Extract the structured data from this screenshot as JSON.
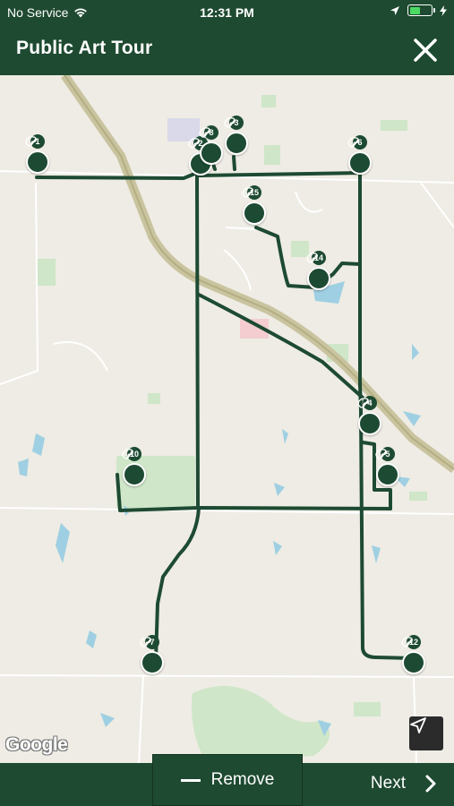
{
  "status_bar": {
    "carrier": "No Service",
    "time": "12:31 PM",
    "battery_level": 0.5
  },
  "header": {
    "title": "Public Art Tour",
    "close_icon": "close-x-icon"
  },
  "map": {
    "attribution": "Google",
    "route_color": "#1d4a32",
    "stops": [
      {
        "number": "1"
      },
      {
        "number": "2"
      },
      {
        "number": "3"
      },
      {
        "number": "4"
      },
      {
        "number": "5"
      },
      {
        "number": "6"
      },
      {
        "number": "7"
      },
      {
        "number": "8"
      },
      {
        "number": "10"
      },
      {
        "number": "12"
      },
      {
        "number": "14"
      },
      {
        "number": "15"
      }
    ]
  },
  "bottom_bar": {
    "remove_label": "Remove",
    "next_label": "Next"
  }
}
